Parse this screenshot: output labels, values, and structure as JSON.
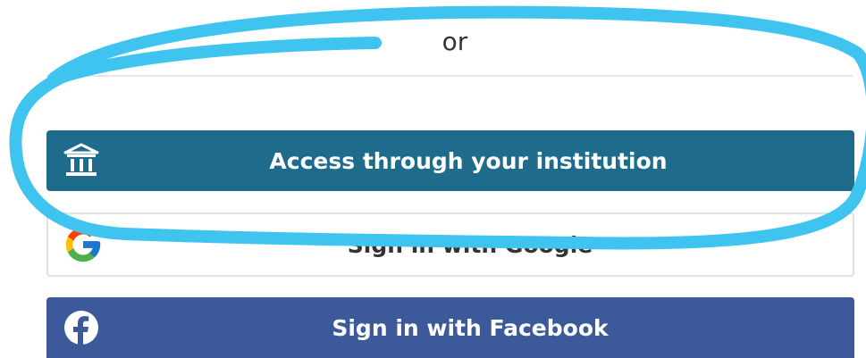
{
  "divider": {
    "text": "or"
  },
  "buttons": {
    "institution": {
      "label": "Access through your institution",
      "icon": "institution-icon"
    },
    "google": {
      "label": "Sign in with Google",
      "icon": "google-icon"
    },
    "facebook": {
      "label": "Sign in with Facebook",
      "icon": "facebook-icon"
    }
  },
  "colors": {
    "institution_bg": "#1e6b8c",
    "facebook_bg": "#3c5a99",
    "highlight_stroke": "#3fc4f0"
  }
}
